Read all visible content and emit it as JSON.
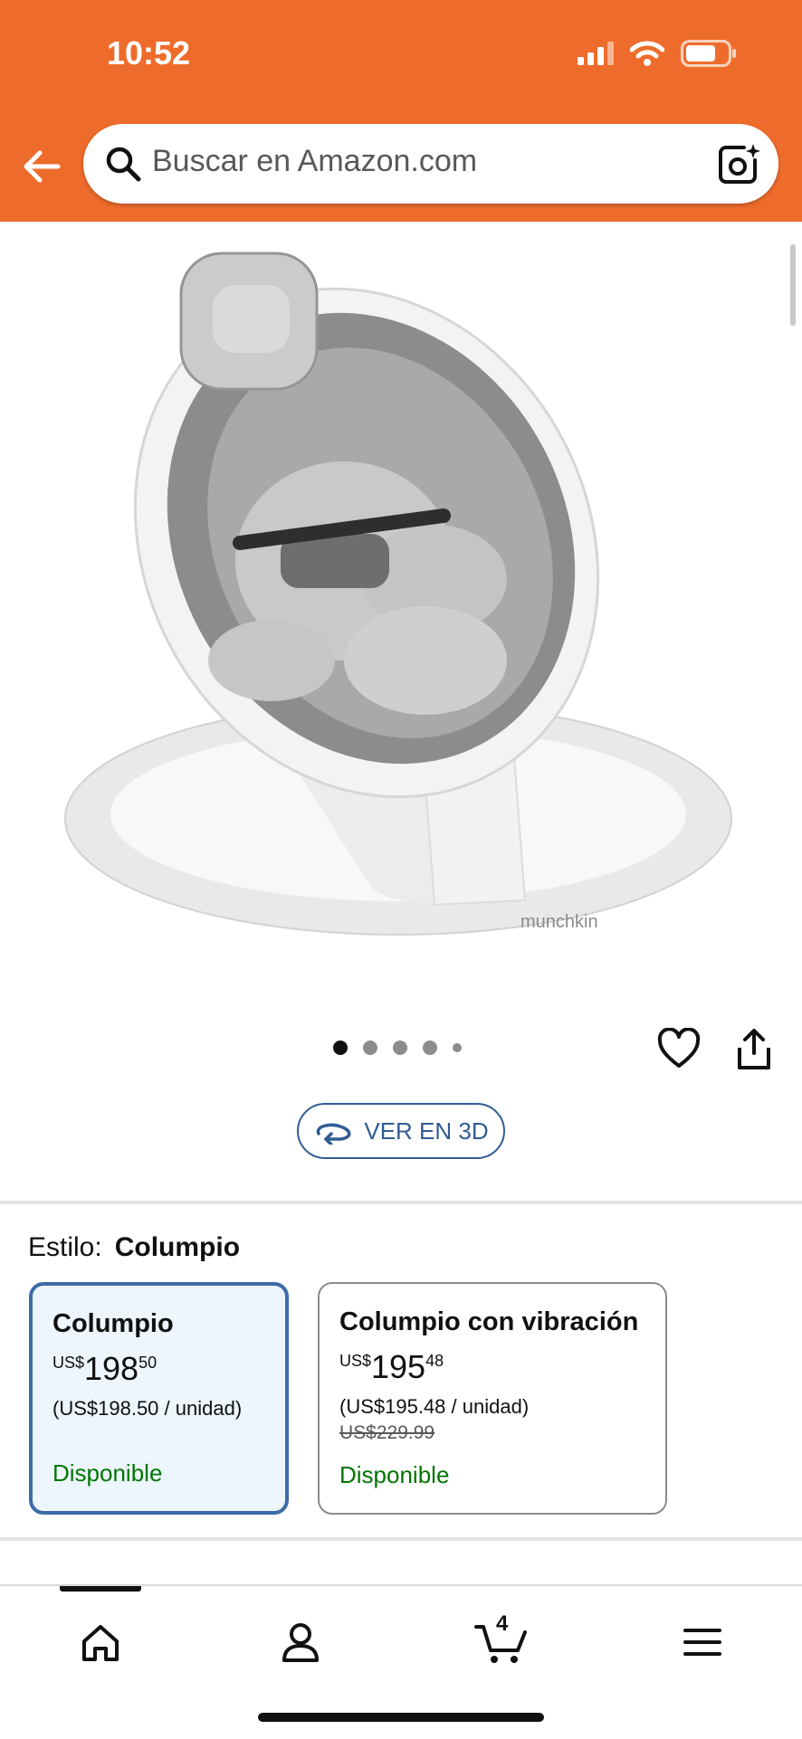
{
  "status": {
    "time": "10:52"
  },
  "search": {
    "placeholder": "Buscar en Amazon.com"
  },
  "gallery": {
    "brand_mark": "munchkin",
    "pages": 5,
    "current_page": 1
  },
  "view3d": {
    "label": "VER EN 3D"
  },
  "style": {
    "label": "Estilo:",
    "value": "Columpio",
    "options": [
      {
        "title": "Columpio",
        "currency": "US$",
        "whole": "198",
        "fraction": "50",
        "unit": "(US$198.50 / unidad)",
        "list": "",
        "availability": "Disponible",
        "selected": true
      },
      {
        "title": "Columpio con vibración",
        "currency": "US$",
        "whole": "195",
        "fraction": "48",
        "unit": "(US$195.48 / unidad)",
        "list": "US$229.99",
        "availability": "Disponible",
        "selected": false
      }
    ]
  },
  "nav": {
    "cart_count": "4"
  },
  "colors": {
    "header": "#ee6c2b",
    "link": "#2f5c94",
    "available": "#007600",
    "selected_border": "#3c6ba6"
  }
}
